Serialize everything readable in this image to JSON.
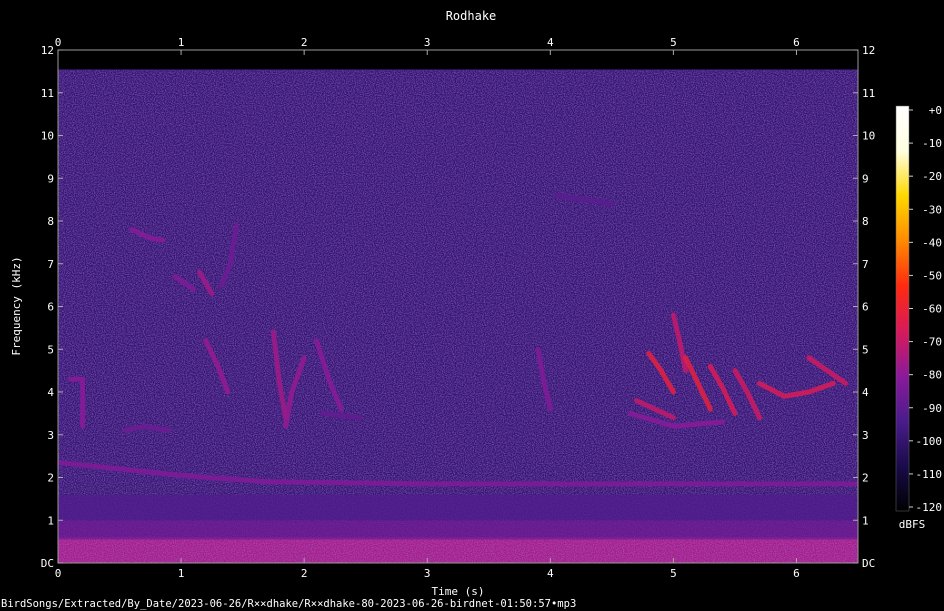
{
  "chart_data": {
    "type": "heatmap",
    "title": "Rodhake",
    "xlabel": "Time (s)",
    "ylabel": "Frequency (kHz)",
    "xlim": [
      0,
      6.5
    ],
    "ylim": [
      0,
      12
    ],
    "x_ticks": [
      "0",
      "1",
      "2",
      "3",
      "4",
      "5",
      "6"
    ],
    "y_ticks": [
      "DC",
      "1",
      "2",
      "3",
      "4",
      "5",
      "6",
      "7",
      "8",
      "9",
      "10",
      "11",
      "12"
    ],
    "colorbar": {
      "label": "dBFS",
      "ticks": [
        "+0",
        "-10",
        "-20",
        "-30",
        "-40",
        "-50",
        "-60",
        "-70",
        "-80",
        "-90",
        "-100",
        "-110",
        "-120"
      ],
      "range": [
        -120,
        0
      ],
      "colormap": [
        "#000000",
        "#1a0b4a",
        "#4a1c8c",
        "#8b1a9a",
        "#d81a5a",
        "#ff2a10",
        "#ff8a00",
        "#ffd800",
        "#ffffe0",
        "#ffffff"
      ]
    },
    "background_db": -100,
    "low_freq_band": {
      "y_range": [
        0,
        0.6
      ],
      "db": -75
    },
    "features": [
      {
        "kind": "band",
        "x": [
          0.0,
          6.5
        ],
        "y": [
          0.55,
          1.0
        ],
        "db": -85
      },
      {
        "kind": "band",
        "x": [
          0.0,
          6.5
        ],
        "y": [
          1.0,
          1.6
        ],
        "db": -92
      },
      {
        "kind": "curve",
        "points": [
          [
            0.0,
            2.35
          ],
          [
            0.5,
            2.2
          ],
          [
            1.0,
            2.05
          ],
          [
            1.7,
            1.9
          ],
          [
            3.0,
            1.85
          ],
          [
            6.5,
            1.85
          ]
        ],
        "db": -82
      },
      {
        "kind": "curve",
        "points": [
          [
            0.1,
            4.3
          ],
          [
            0.2,
            4.3
          ],
          [
            0.2,
            3.2
          ]
        ],
        "db": -80
      },
      {
        "kind": "curve",
        "points": [
          [
            0.55,
            3.1
          ],
          [
            0.7,
            3.2
          ],
          [
            0.9,
            3.1
          ]
        ],
        "db": -86
      },
      {
        "kind": "curve",
        "points": [
          [
            0.6,
            7.8
          ],
          [
            0.75,
            7.6
          ],
          [
            0.85,
            7.55
          ]
        ],
        "db": -80
      },
      {
        "kind": "curve",
        "points": [
          [
            0.95,
            6.7
          ],
          [
            1.05,
            6.5
          ],
          [
            1.1,
            6.4
          ]
        ],
        "db": -82
      },
      {
        "kind": "curve",
        "points": [
          [
            1.15,
            6.8
          ],
          [
            1.25,
            6.3
          ]
        ],
        "db": -76
      },
      {
        "kind": "curve",
        "points": [
          [
            1.2,
            5.2
          ],
          [
            1.3,
            4.6
          ],
          [
            1.38,
            4.0
          ]
        ],
        "db": -78
      },
      {
        "kind": "curve",
        "points": [
          [
            1.45,
            7.9
          ],
          [
            1.4,
            7.0
          ],
          [
            1.33,
            6.5
          ]
        ],
        "db": -86
      },
      {
        "kind": "curve",
        "points": [
          [
            1.75,
            5.4
          ],
          [
            1.8,
            4.2
          ],
          [
            1.85,
            3.4
          ]
        ],
        "db": -76
      },
      {
        "kind": "curve",
        "points": [
          [
            2.0,
            4.8
          ],
          [
            1.9,
            4.0
          ],
          [
            1.85,
            3.2
          ]
        ],
        "db": -78
      },
      {
        "kind": "curve",
        "points": [
          [
            2.1,
            5.2
          ],
          [
            2.2,
            4.3
          ],
          [
            2.3,
            3.6
          ]
        ],
        "db": -80
      },
      {
        "kind": "curve",
        "points": [
          [
            2.15,
            3.5
          ],
          [
            2.45,
            3.4
          ]
        ],
        "db": -88
      },
      {
        "kind": "curve",
        "points": [
          [
            3.9,
            5.0
          ],
          [
            3.95,
            4.2
          ],
          [
            4.0,
            3.6
          ]
        ],
        "db": -82
      },
      {
        "kind": "curve",
        "points": [
          [
            4.05,
            8.6
          ],
          [
            4.5,
            8.4
          ]
        ],
        "db": -90
      },
      {
        "kind": "curve",
        "points": [
          [
            4.7,
            3.8
          ],
          [
            4.85,
            3.6
          ],
          [
            5.0,
            3.4
          ]
        ],
        "db": -70
      },
      {
        "kind": "curve",
        "points": [
          [
            4.8,
            4.9
          ],
          [
            4.9,
            4.5
          ],
          [
            5.0,
            4.0
          ]
        ],
        "db": -62
      },
      {
        "kind": "curve",
        "points": [
          [
            5.0,
            5.8
          ],
          [
            5.05,
            5.2
          ],
          [
            5.1,
            4.5
          ]
        ],
        "db": -70
      },
      {
        "kind": "curve",
        "points": [
          [
            5.1,
            4.8
          ],
          [
            5.2,
            4.2
          ],
          [
            5.3,
            3.6
          ]
        ],
        "db": -62
      },
      {
        "kind": "curve",
        "points": [
          [
            5.3,
            4.6
          ],
          [
            5.4,
            4.1
          ],
          [
            5.5,
            3.5
          ]
        ],
        "db": -66
      },
      {
        "kind": "curve",
        "points": [
          [
            5.5,
            4.5
          ],
          [
            5.6,
            4.0
          ],
          [
            5.7,
            3.4
          ]
        ],
        "db": -68
      },
      {
        "kind": "curve",
        "points": [
          [
            5.7,
            4.2
          ],
          [
            5.9,
            3.9
          ],
          [
            6.1,
            4.0
          ],
          [
            6.3,
            4.2
          ]
        ],
        "db": -66
      },
      {
        "kind": "curve",
        "points": [
          [
            6.1,
            4.8
          ],
          [
            6.25,
            4.5
          ],
          [
            6.4,
            4.2
          ]
        ],
        "db": -68
      },
      {
        "kind": "curve",
        "points": [
          [
            4.65,
            3.5
          ],
          [
            5.0,
            3.2
          ],
          [
            5.4,
            3.3
          ]
        ],
        "db": -80
      }
    ]
  },
  "footer": {
    "path": "BirdSongs/Extracted/By_Date/2023-06-26/R××dhake/R××dhake-80-2023-06-26-birdnet-01:50:57•mp3"
  }
}
